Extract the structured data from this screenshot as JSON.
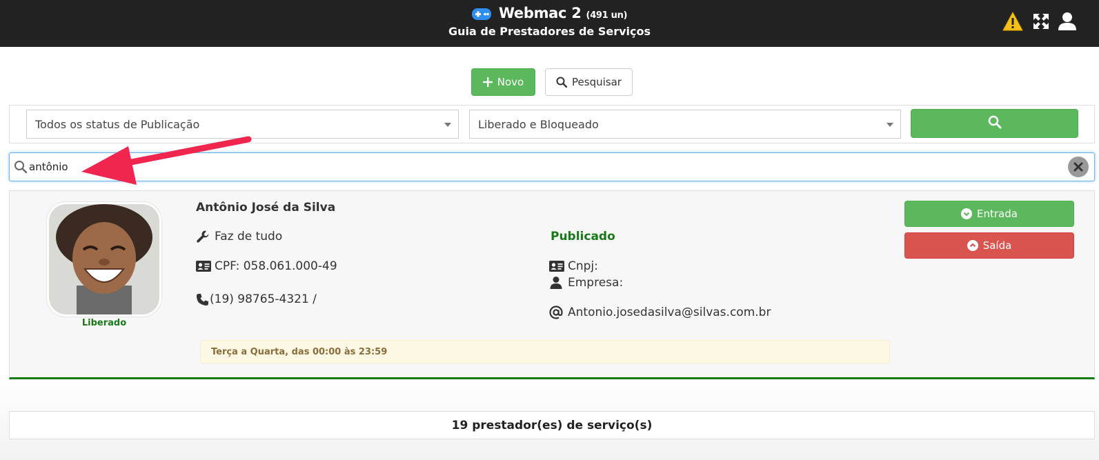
{
  "header": {
    "app_name": "Webmac 2",
    "count": "(491 un)",
    "subtitle": "Guia de Prestadores de Serviços",
    "icons": [
      "gamepad-icon",
      "warning-icon",
      "expand-icon",
      "user-icon"
    ]
  },
  "toolbar": {
    "new_label": "Novo",
    "search_label": "Pesquisar"
  },
  "filters": {
    "status_select": "Todos os status de Publicação",
    "access_select": "Liberado e Bloqueado"
  },
  "search": {
    "value": "antônio"
  },
  "provider": {
    "name": "Antônio José da Silva",
    "status": "Liberado",
    "service": "Faz de tudo",
    "cpf": "CPF: 058.061.000-49",
    "phone": "(19) 98765-4321 /",
    "publication": "Publicado",
    "cnpj": "Cnpj:",
    "company": "Empresa:",
    "email": "Antonio.josedasilva@silvas.com.br",
    "schedule": "Terça a Quarta, das 00:00 às 23:59",
    "entry_label": "Entrada",
    "exit_label": "Saída"
  },
  "footer": {
    "count_text": "19 prestador(es) de serviço(s)"
  },
  "colors": {
    "header_bg": "#222222",
    "success": "#5cb85c",
    "danger": "#d9534f",
    "status_green": "#177a17",
    "warning_bg": "#fcf8e3",
    "annotation_arrow": "#f0264f"
  }
}
